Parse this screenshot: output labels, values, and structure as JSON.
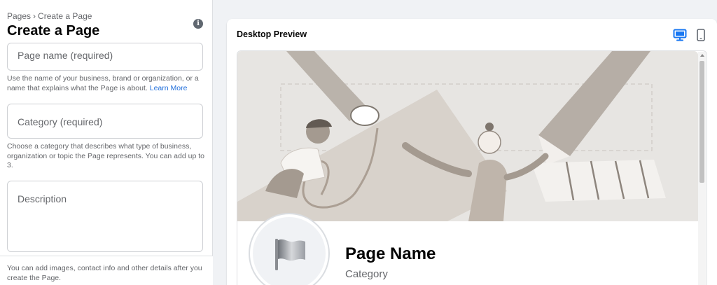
{
  "form": {
    "breadcrumb": {
      "parent": "Pages",
      "separator": "›",
      "current": "Create a Page"
    },
    "title": "Create a Page",
    "info_icon": "info-icon",
    "page_name": {
      "placeholder": "Page name (required)",
      "value": ""
    },
    "page_name_help": "Use the name of your business, brand or organization, or a name that explains what the Page is about.",
    "learn_more": "Learn More",
    "category": {
      "placeholder": "Category (required)",
      "value": ""
    },
    "category_help": "Choose a category that describes what type of business, organization or topic the Page represents. You can add up to 3.",
    "description": {
      "placeholder": "Description",
      "value": ""
    },
    "footer_note": "You can add images, contact info and other details after you create the Page."
  },
  "preview": {
    "title": "Desktop Preview",
    "devices": [
      {
        "name": "desktop",
        "icon": "desktop-monitor-icon",
        "active": true
      },
      {
        "name": "mobile",
        "icon": "mobile-phone-icon",
        "active": false
      }
    ],
    "page_name": "Page Name",
    "category": "Category"
  },
  "colors": {
    "accent": "#1877f2",
    "link": "#216fdb",
    "cover_background": "#e7e5e2"
  }
}
